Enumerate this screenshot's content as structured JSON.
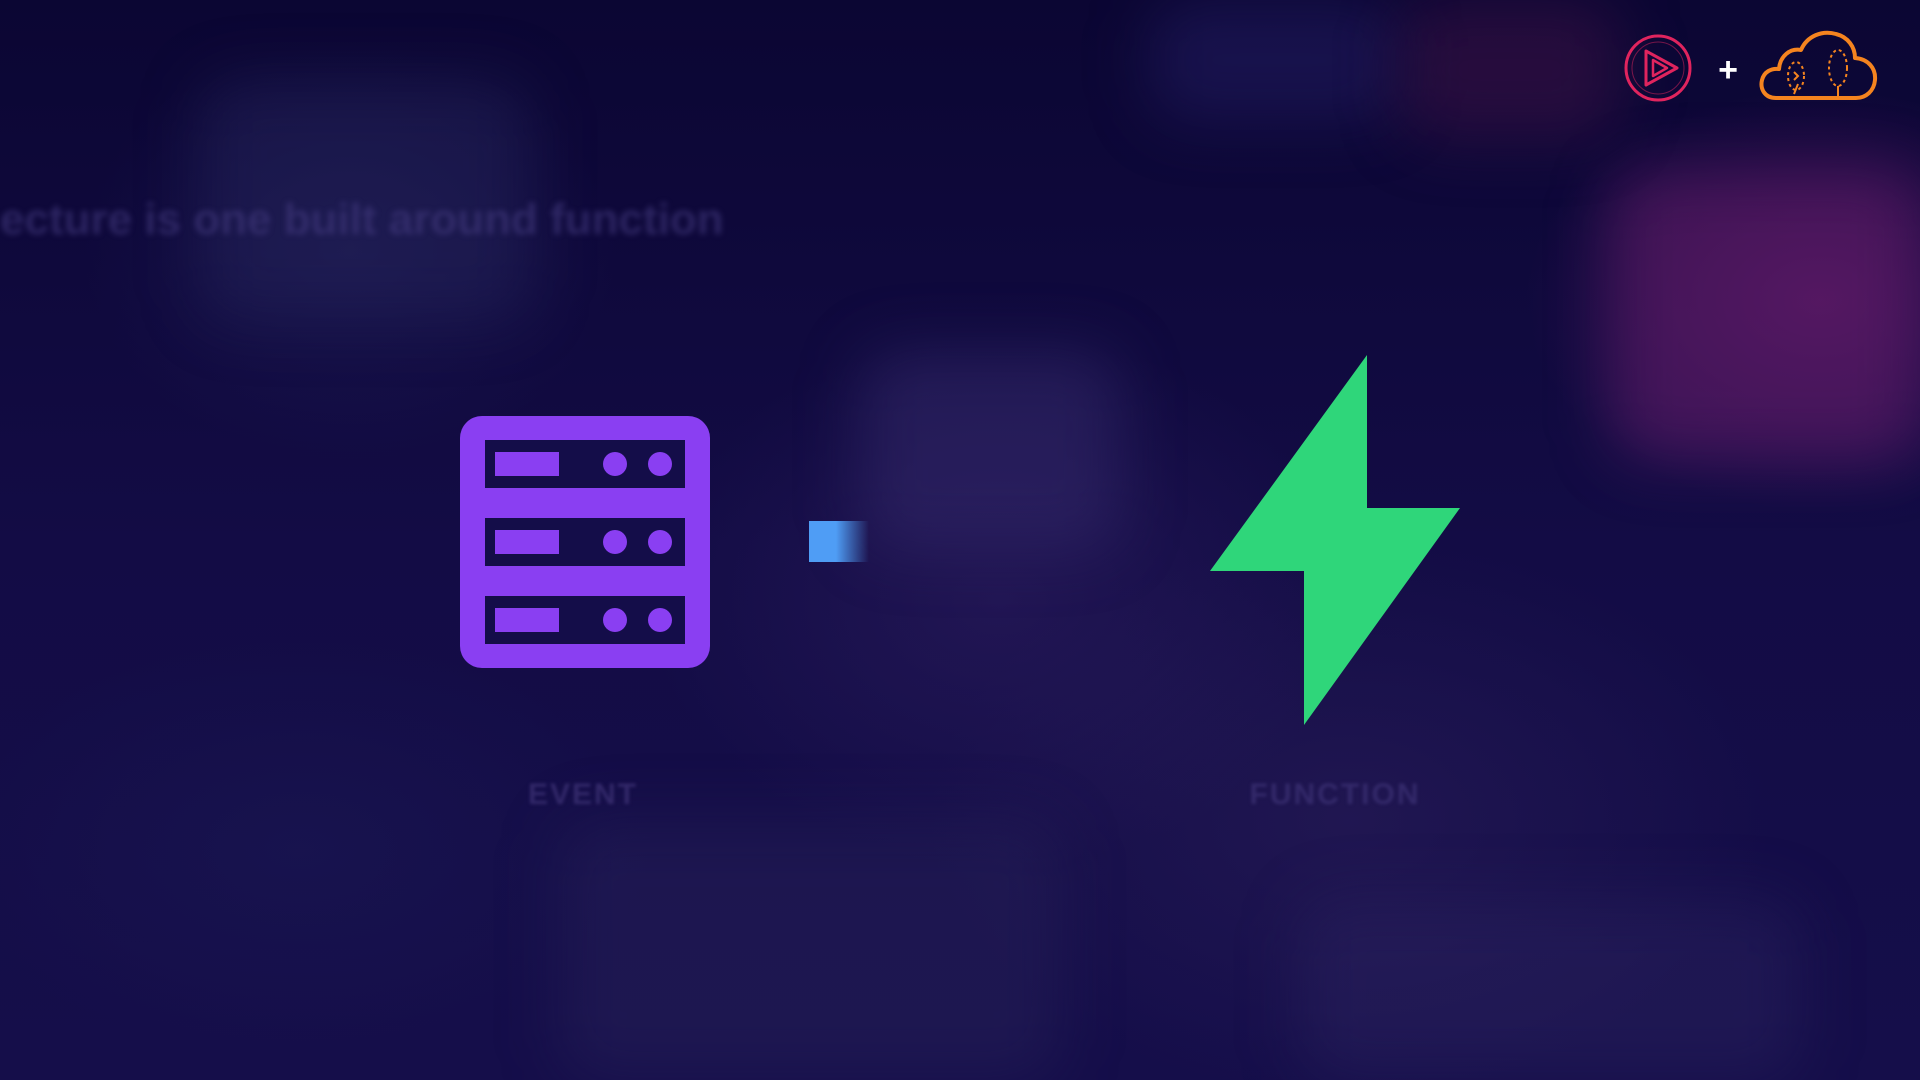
{
  "background": {
    "heading_text": "ecture is one built around function"
  },
  "header": {
    "plus_symbol": "+",
    "play_logo_color": "#e0245e",
    "cloud_logo_color": "#f5841f"
  },
  "diagram": {
    "event_label": "EVENT",
    "function_label": "FUNCTION",
    "event_icon": "server-icon",
    "function_icon": "lightning-bolt-icon",
    "event_color": "#8a3ff2",
    "function_color": "#2fd67a",
    "connector_color": "#4f9df5"
  }
}
